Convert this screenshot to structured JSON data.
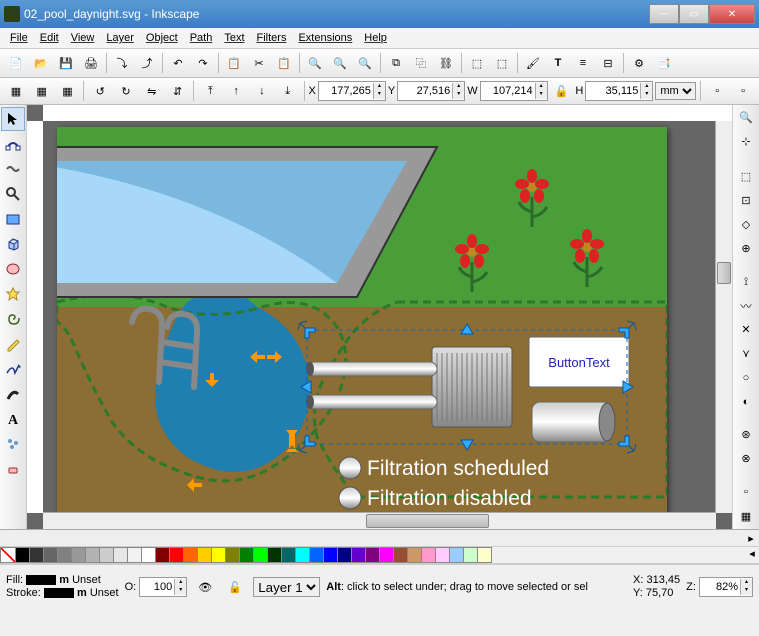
{
  "window": {
    "title": "02_pool_daynight.svg - Inkscape"
  },
  "menu": {
    "file": "File",
    "edit": "Edit",
    "view": "View",
    "layer": "Layer",
    "object": "Object",
    "path": "Path",
    "text": "Text",
    "filters": "Filters",
    "extensions": "Extensions",
    "help": "Help"
  },
  "coords": {
    "xlabel": "X",
    "x": "177,265",
    "ylabel": "Y",
    "y": "27,516",
    "wlabel": "W",
    "w": "107,214",
    "hlabel": "H",
    "h": "35,115",
    "unit": "mm"
  },
  "canvas": {
    "button_text": "ButtonText",
    "filtration_scheduled": "Filtration scheduled",
    "filtration_disabled": "Filtration disabled"
  },
  "status": {
    "fill_label": "Fill:",
    "fill_val": "m",
    "stroke_label": "Stroke:",
    "stroke_val": "m",
    "unset": "Unset",
    "o_label": "O:",
    "o_val": "100",
    "layer": "Layer 1",
    "hint_label": "Alt",
    "hint": ": click to select under; drag to move selected or sel",
    "px": "X:",
    "px_val": "313,45",
    "py": "Y:",
    "py_val": "75,70",
    "z": "Z:",
    "z_val": "82%"
  },
  "palette": [
    "#000000",
    "#333333",
    "#666666",
    "#808080",
    "#999999",
    "#b3b3b3",
    "#cccccc",
    "#e6e6e6",
    "#f2f2f2",
    "#ffffff",
    "#800000",
    "#ff0000",
    "#ff6600",
    "#ffcc00",
    "#ffff00",
    "#808000",
    "#008000",
    "#00ff00",
    "#003300",
    "#006666",
    "#00ffff",
    "#0066ff",
    "#0000ff",
    "#000080",
    "#6600cc",
    "#800080",
    "#ff00ff",
    "#994d33",
    "#cc9966",
    "#ff99cc",
    "#ffccff",
    "#99ccff",
    "#ccffcc",
    "#ffffcc"
  ]
}
